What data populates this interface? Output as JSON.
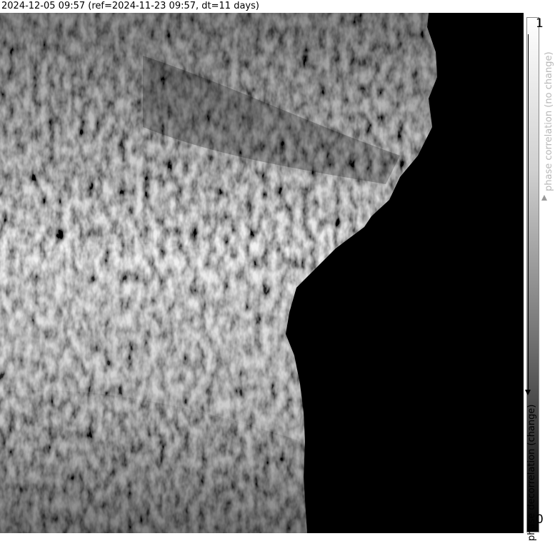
{
  "title": "2024-12-05 09:57 (ref=2024-11-23 09:57, dt=11 days)",
  "image": {
    "description_icon": "sar-phase-correlation-map",
    "background": "#000000"
  },
  "colorbar": {
    "max_label": "1",
    "min_label": "0",
    "top_label": "phase correlation (no change)",
    "bottom_label": "phase decorrelation (change)",
    "top_label_color": "#b8b8b8",
    "bottom_label_color": "#000000"
  }
}
